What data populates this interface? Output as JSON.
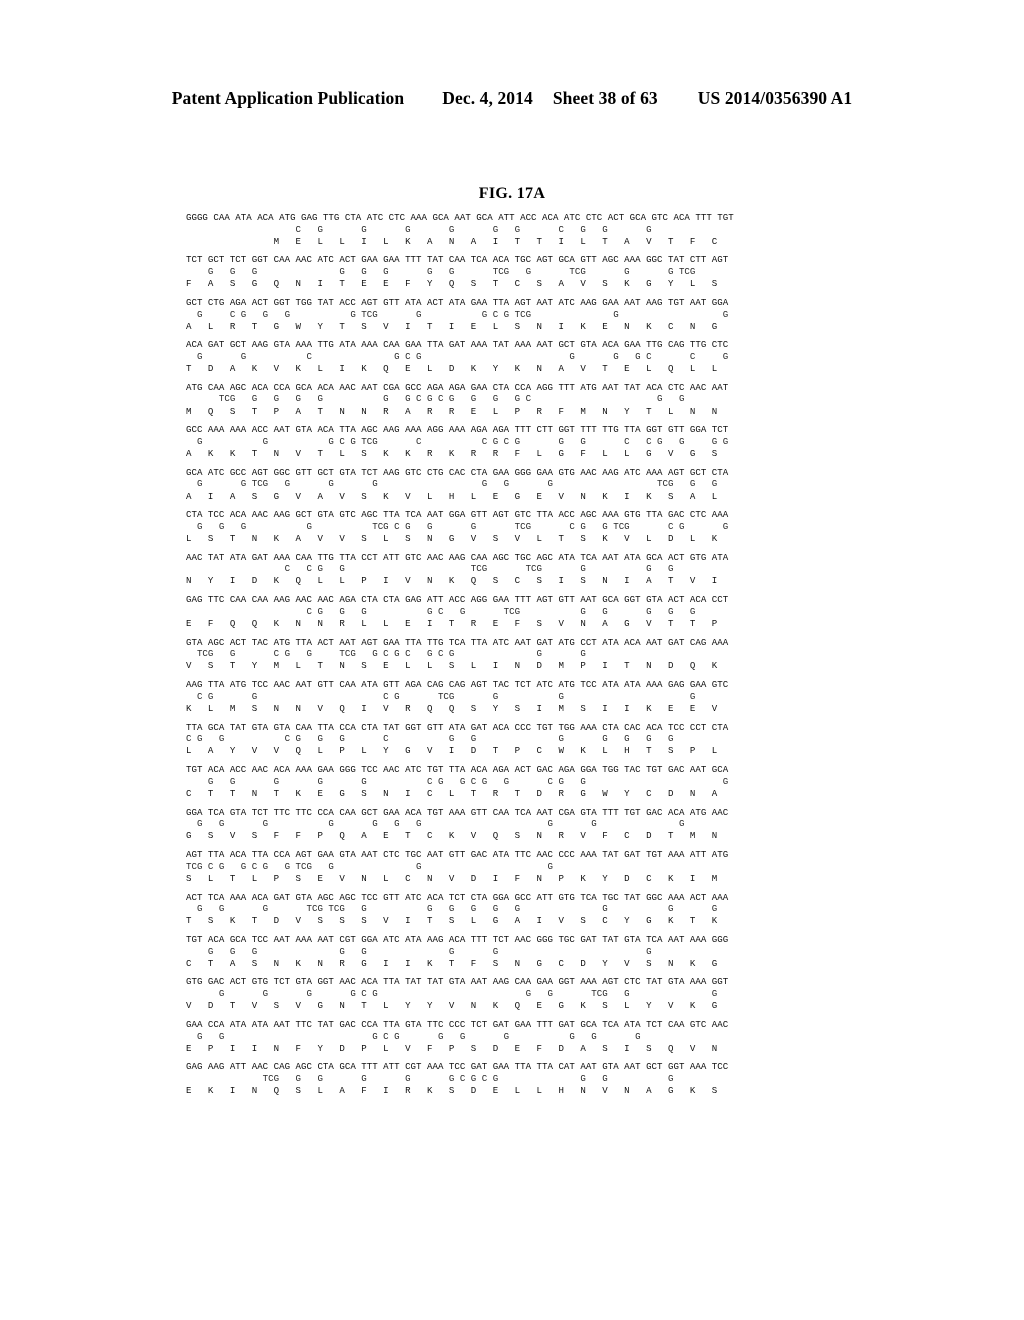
{
  "header": {
    "publication_label": "Patent Application Publication",
    "date": "Dec. 4, 2014",
    "sheet": "Sheet 38 of 63",
    "document_number": "US 2014/0356390 A1"
  },
  "figure": {
    "title": "FIG. 17A"
  },
  "sequence": {
    "blocks": [
      {
        "dna": "GGGG CAA ATA ACA ATG GAG TTG CTA ATC CTC AAA GCA AAT GCA ATT ACC ACA ATC CTC ACT GCA GTC ACA TTT TGT",
        "alt": "                    C   G       G       G       G       G   G       C   G   G       G",
        "aa": "                M   E   L   L   I   L   K   A   N   A   I   T   T   I   L   T   A   V   T   F   C"
      },
      {
        "dna": "TCT GCT TCT GGT CAA AAC ATC ACT GAA GAA TTT TAT CAA TCA ACA TGC AGT GCA GTT AGC AAA GGC TAT CTT AGT",
        "alt": "    G   G   G               G   G   G       G   G       TCG   G       TCG       G       G TCG",
        "aa": "F   A   S   G   Q   N   I   T   E   E   F   Y   Q   S   T   C   S   A   V   S   K   G   Y   L   S"
      },
      {
        "dna": "GCT CTG AGA ACT GGT TGG TAT ACC AGT GTT ATA ACT ATA GAA TTA AGT AAT ATC AAG GAA AAT AAG TGT AAT GGA",
        "alt": "  G     C G   G   G           G TCG       G           G C G TCG               G                   G",
        "aa": "A   L   R   T   G   W   Y   T   S   V   I   T   I   E   L   S   N   I   K   E   N   K   C   N   G"
      },
      {
        "dna": "ACA GAT GCT AAG GTA AAA TTG ATA AAA CAA GAA TTA GAT AAA TAT AAA AAT GCT GTA ACA GAA TTG CAG TTG CTC",
        "alt": "  G       G           C               G C G                           G       G   G C       C     G",
        "aa": "T   D   A   K   V   K   L   I   K   Q   E   L   D   K   Y   K   N   A   V   T   E   L   Q   L   L"
      },
      {
        "dna": "ATG CAA AGC ACA CCA GCA ACA AAC AAT CGA GCC AGA AGA GAA CTA CCA AGG TTT ATG AAT TAT ACA CTC AAC AAT",
        "alt": "      TCG   G   G   G   G           G   G C G C G   G   G   G C                       G   G",
        "aa": "M   Q   S   T   P   A   T   N   N   R   A   R   R   E   L   P   R   F   M   N   Y   T   L   N   N"
      },
      {
        "dna": "GCC AAA AAA ACC AAT GTA ACA TTA AGC AAG AAA AGG AAA AGA AGA TTT CTT GGT TTT TTG TTA GGT GTT GGA TCT",
        "alt": "  G           G           G C G TCG       C           C G C G       G   G       C   C G   G     G G",
        "aa": "A   K   K   T   N   V   T   L   S   K   K   R   K   R   R   F   L   G   F   L   L   G   V   G   S"
      },
      {
        "dna": "GCA ATC GCC AGT GGC GTT GCT GTA TCT AAG GTC CTG CAC CTA GAA GGG GAA GTG AAC AAG ATC AAA AGT GCT CTA",
        "alt": "  G       G TCG   G       G       G                   G   G       G                   TCG   G   G",
        "aa": "A   I   A   S   G   V   A   V   S   K   V   L   H   L   E   G   E   V   N   K   I   K   S   A   L"
      },
      {
        "dna": "CTA TCC ACA AAC AAG GCT GTA GTC AGC TTA TCA AAT GGA GTT AGT GTC TTA ACC AGC AAA GTG TTA GAC CTC AAA",
        "alt": "  G   G   G           G           TCG C G   G       G       TCG       C G   G TCG       C G       G",
        "aa": "L   S   T   N   K   A   V   V   S   L   S   N   G   V   S   V   L   T   S   K   V   L   D   L   K"
      },
      {
        "dna": "AAC TAT ATA GAT AAA CAA TTG TTA CCT ATT GTC AAC AAG CAA AGC TGC AGC ATA TCA AAT ATA GCA ACT GTG ATA",
        "alt": "                  C   C G   G                       TCG       TCG       G           G   G",
        "aa": "N   Y   I   D   K   Q   L   L   P   I   V   N   K   Q   S   C   S   I   S   N   I   A   T   V   I"
      },
      {
        "dna": "GAG TTC CAA CAA AAG AAC AAC AGA CTA CTA GAG ATT ACC AGG GAA TTT AGT GTT AAT GCA GGT GTA ACT ACA CCT",
        "alt": "                      C G   G   G           G C   G       TCG           G   G       G   G   G",
        "aa": "E   F   Q   Q   K   N   N   R   L   L   E   I   T   R   E   F   S   V   N   A   G   V   T   T   P"
      },
      {
        "dna": "GTA AGC ACT TAC ATG TTA ACT AAT AGT GAA TTA TTG TCA TTA ATC AAT GAT ATG CCT ATA ACA AAT GAT CAG AAA",
        "alt": "  TCG   G       C G   G     TCG   G C G C   G C G               G       G",
        "aa": "V   S   T   Y   M   L   T   N   S   E   L   L   S   L   I   N   D   M   P   I   T   N   D   Q   K"
      },
      {
        "dna": "AAG TTA ATG TCC AAC AAT GTT CAA ATA GTT AGA CAG CAG AGT TAC TCT ATC ATG TCC ATA ATA AAA GAG GAA GTC",
        "alt": "  C G       G                       C G       TCG       G           G                       G",
        "aa": "K   L   M   S   N   N   V   Q   I   V   R   Q   Q   S   Y   S   I   M   S   I   I   K   E   E   V"
      },
      {
        "dna": "TTA GCA TAT GTA GTA CAA TTA CCA CTA TAT GGT GTT ATA GAT ACA CCC TGT TGG AAA CTA CAC ACA TCC CCT CTA",
        "alt": "C G   G           C G   G   G       C           G   G               G       G   G   G   G",
        "aa": "L   A   Y   V   V   Q   L   P   L   Y   G   V   I   D   T   P   C   W   K   L   H   T   S   P   L"
      },
      {
        "dna": "TGT ACA ACC AAC ACA AAA GAA GGG TCC AAC ATC TGT TTA ACA AGA ACT GAC AGA GGA TGG TAC TGT GAC AAT GCA",
        "alt": "    G   G       G       G       G           C G   G C G   G       C G   G                         G",
        "aa": "C   T   T   N   T   K   E   G   S   N   I   C   L   T   R   T   D   R   G   W   Y   C   D   N   A"
      },
      {
        "dna": "GGA TCA GTA TCT TTC TTC CCA CAA GCT GAA ACA TGT AAA GTT CAA TCA AAT CGA GTA TTT TGT GAC ACA ATG AAC",
        "alt": "  G   G       G           G       G   G   G                       G       G               G",
        "aa": "G   S   V   S   F   F   P   Q   A   E   T   C   K   V   Q   S   N   R   V   F   C   D   T   M   N"
      },
      {
        "dna": "AGT TTA ACA TTA CCA AGT GAA GTA AAT CTC TGC AAT GTT GAC ATA TTC AAC CCC AAA TAT GAT TGT AAA ATT ATG",
        "alt": "TCG C G   G C G   G TCG   G               G                       G",
        "aa": "S   L   T   L   P   S   E   V   N   L   C   N   V   D   I   F   N   P   K   Y   D   C   K   I   M"
      },
      {
        "dna": "ACT TCA AAA ACA GAT GTA AGC AGC TCC GTT ATC ACA TCT CTA GGA GCC ATT GTG TCA TGC TAT GGC AAA ACT AAA",
        "alt": "  G   G       G       TCG TCG   G           G   G   G   G   G               G           G       G",
        "aa": "T   S   K   T   D   V   S   S   S   V   I   T   S   L   G   A   I   V   S   C   Y   G   K   T   K"
      },
      {
        "dna": "TGT ACA GCA TCC AAT AAA AAT CGT GGA ATC ATA AAG ACA TTT TCT AAC GGG TGC GAT TAT GTA TCA AAT AAA GGG",
        "alt": "    G   G   G               G   G               G       G                           G",
        "aa": "C   T   A   S   N   K   N   R   G   I   I   K   T   F   S   N   G   C   D   Y   V   S   N   K   G"
      },
      {
        "dna": "GTG GAC ACT GTG TCT GTA GGT AAC ACA TTA TAT TAT GTA AAT AAG CAA GAA GGT AAA AGT CTC TAT GTA AAA GGT",
        "alt": "      G       G       G       G C G                           G   G       TCG   G               G",
        "aa": "V   D   T   V   S   V   G   N   T   L   Y   Y   V   N   K   Q   E   G   K   S   L   Y   V   K   G"
      },
      {
        "dna": "GAA CCA ATA ATA AAT TTC TAT GAC CCA TTA GTA TTC CCC TCT GAT GAA TTT GAT GCA TCA ATA TCT CAA GTC AAC",
        "alt": "  G   G                           G C G       G   G       G           G   G       G",
        "aa": "E   P   I   I   N   F   Y   D   P   L   V   F   P   S   D   E   F   D   A   S   I   S   Q   V   N"
      },
      {
        "dna": "GAG AAG ATT AAC CAG AGC CTA GCA TTT ATT CGT AAA TCC GAT GAA TTA TTA CAT AAT GTA AAT GCT GGT AAA TCC",
        "alt": "              TCG   G   G       G       G       G C G C G               G   G           G",
        "aa": "E   K   I   N   Q   S   L   A   F   I   R   K   S   D   E   L   L   H   N   V   N   A   G   K   S"
      }
    ]
  }
}
